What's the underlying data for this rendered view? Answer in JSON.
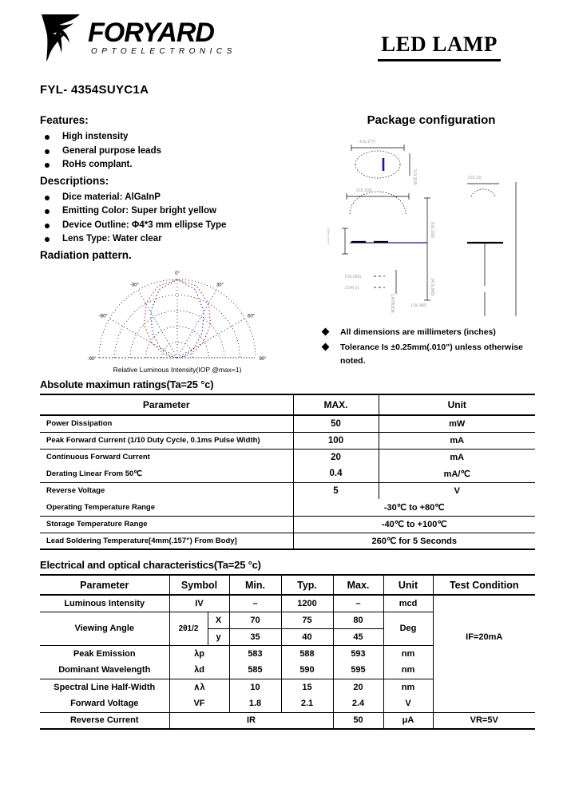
{
  "header": {
    "logo_name": "FORYARD",
    "logo_sub": "OPTOELECTRONICS",
    "doc_title": "LED LAMP"
  },
  "model": "FYL- 4354SUYC1A",
  "left": {
    "features_heading": "Features:",
    "features": [
      "High instensity",
      "General purpose leads",
      "RoHs complant."
    ],
    "descriptions_heading": "Descriptions:",
    "descriptions": [
      "Dice material: AlGaInP",
      "Emitting Color: Super bright yellow",
      "Device Outline: Φ4*3 mm ellipse Type",
      "Lens Type: Water clear"
    ],
    "radiation_heading": "Radiation pattern."
  },
  "package": {
    "title": "Package configuration",
    "notes": [
      "All dimensions are millimeters (inches)",
      "Tolerance  Is  ±0.25mm(.010\")  unless otherwise noted."
    ]
  },
  "chart_data": {
    "type": "line",
    "title": "Radiation pattern",
    "xlabel": "Relative Luminous Intensity(IOP @max=1)",
    "polar": true,
    "angle_range": [
      -90,
      90
    ],
    "angle_ticks": [
      -90,
      -60,
      -30,
      0,
      30,
      60,
      90
    ],
    "radial_ticks": [
      0.2,
      0.4,
      0.6,
      0.8,
      1.0
    ],
    "series": [
      {
        "name": "curve-outer",
        "color": "#cc0000",
        "angles": [
          -90,
          -75,
          -60,
          -45,
          -30,
          -15,
          0,
          15,
          30,
          45,
          60,
          75,
          90
        ],
        "values": [
          0.05,
          0.18,
          0.38,
          0.6,
          0.8,
          0.95,
          1.0,
          0.95,
          0.8,
          0.6,
          0.38,
          0.18,
          0.05
        ]
      },
      {
        "name": "curve-inner",
        "color": "#0000cc",
        "angles": [
          -90,
          -75,
          -60,
          -45,
          -30,
          -15,
          0,
          15,
          30,
          45,
          60,
          75,
          90
        ],
        "values": [
          0.02,
          0.1,
          0.25,
          0.45,
          0.68,
          0.9,
          1.0,
          0.9,
          0.68,
          0.45,
          0.25,
          0.1,
          0.02
        ]
      }
    ]
  },
  "abs_table": {
    "title": "Absolute maximun ratings(Ta=25  °c)",
    "columns": [
      "Parameter",
      "MAX.",
      "Unit"
    ],
    "rows": [
      {
        "parameter": "Power Dissipation",
        "max": "50",
        "unit": "mW",
        "span": false
      },
      {
        "parameter": "Peak Forward Current (1/10 Duty Cycle, 0.1ms Pulse Width)",
        "max": "100",
        "unit": "mA",
        "span": false
      },
      {
        "parameter": "Continuous Forward Current",
        "max": "20",
        "unit": "mA",
        "span": false
      },
      {
        "parameter": "Derating Linear From 50℃",
        "max": "0.4",
        "unit": "mA/℃",
        "span": false
      },
      {
        "parameter": "Reverse Voltage",
        "max": "5",
        "unit": "V",
        "span": false
      },
      {
        "parameter": "Operating Temperature Range",
        "value": "-30℃ to +80℃",
        "span": true
      },
      {
        "parameter": "Storage Temperature Range",
        "value": "-40℃ to +100℃",
        "span": true
      },
      {
        "parameter": "Lead Soldering Temperature[4mm(.157\") From Body]",
        "value": "260℃ for 5 Seconds",
        "span": true
      }
    ]
  },
  "elec_table": {
    "title": "Electrical and optical characteristics(Ta=25  °c)",
    "columns": [
      "Parameter",
      "Symbol",
      "Min.",
      "Typ.",
      "Max.",
      "Unit",
      "Test Condition"
    ],
    "rows": [
      {
        "parameter": "Luminous Intensity",
        "symbol": "IV",
        "min": "–",
        "typ": "1200",
        "max": "–",
        "unit": "mcd"
      },
      {
        "parameter": "Viewing Angle",
        "symbol": "2θ1/2",
        "axis": "X",
        "min": "70",
        "typ": "75",
        "max": "80",
        "unit": "Deg"
      },
      {
        "parameter": "",
        "symbol": "",
        "axis": "y",
        "min": "35",
        "typ": "40",
        "max": "45",
        "unit": ""
      },
      {
        "parameter": "Peak Emission",
        "symbol": "λp",
        "min": "583",
        "typ": "588",
        "max": "593",
        "unit": "nm"
      },
      {
        "parameter": "Dominant Wavelength",
        "symbol": "λd",
        "min": "585",
        "typ": "590",
        "max": "595",
        "unit": "nm"
      },
      {
        "parameter": "Spectral Line Half-Width",
        "symbol": "∧λ",
        "min": "10",
        "typ": "15",
        "max": "20",
        "unit": "nm"
      },
      {
        "parameter": "Forward Voltage",
        "symbol": "VF",
        "min": "1.8",
        "typ": "2.1",
        "max": "2.4",
        "unit": "V"
      },
      {
        "parameter": "Reverse Current",
        "symbol": "IR",
        "min": "",
        "typ": "",
        "max": "50",
        "unit": "μA"
      }
    ],
    "test_condition_main": "IF=20mA",
    "test_condition_last": "VR=5V"
  }
}
